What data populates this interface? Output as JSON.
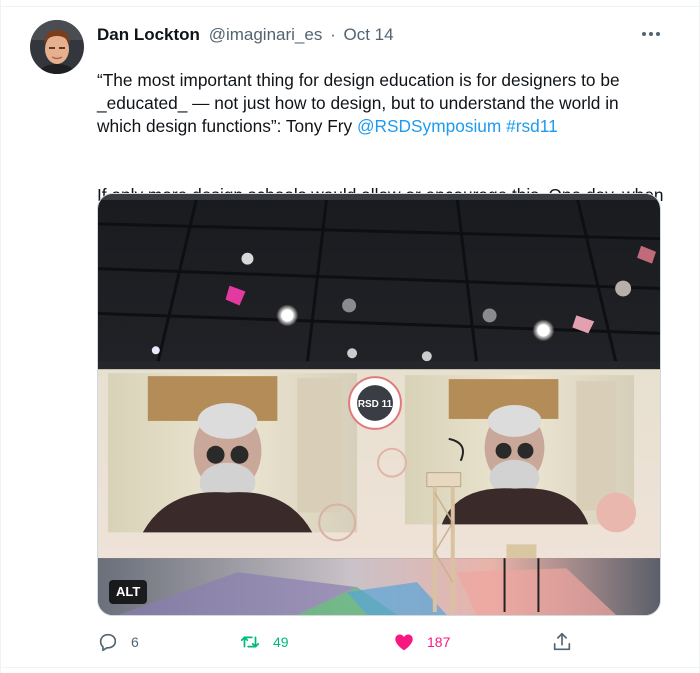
{
  "tweet": {
    "author_name": "Dan Lockton",
    "handle": "@imaginari_es",
    "separator": "·",
    "date": "Oct 14",
    "text": {
      "quote": "“The most important thing for design education is for designers to be _educated_ — not just how to design, but to understand the world in which design functions”: Tony Fry",
      "mention": "@RSDSymposium",
      "hashtag": "#rsd11",
      "follow_up": "If only more design schools would allow or encourage this. One day, when it’s too late"
    },
    "media": {
      "alt_badge": "ALT",
      "screen_logo": "RSD 11"
    },
    "actions": {
      "replies": "6",
      "retweets": "49",
      "likes": "187"
    },
    "icons": [
      "avatar",
      "more-options-icon",
      "reply-icon",
      "retweet-icon",
      "heart-icon",
      "share-icon"
    ],
    "colors": {
      "link": "#1d9bf0",
      "retweet": "#00ba7c",
      "like": "#f91880",
      "muted": "#536471"
    }
  }
}
